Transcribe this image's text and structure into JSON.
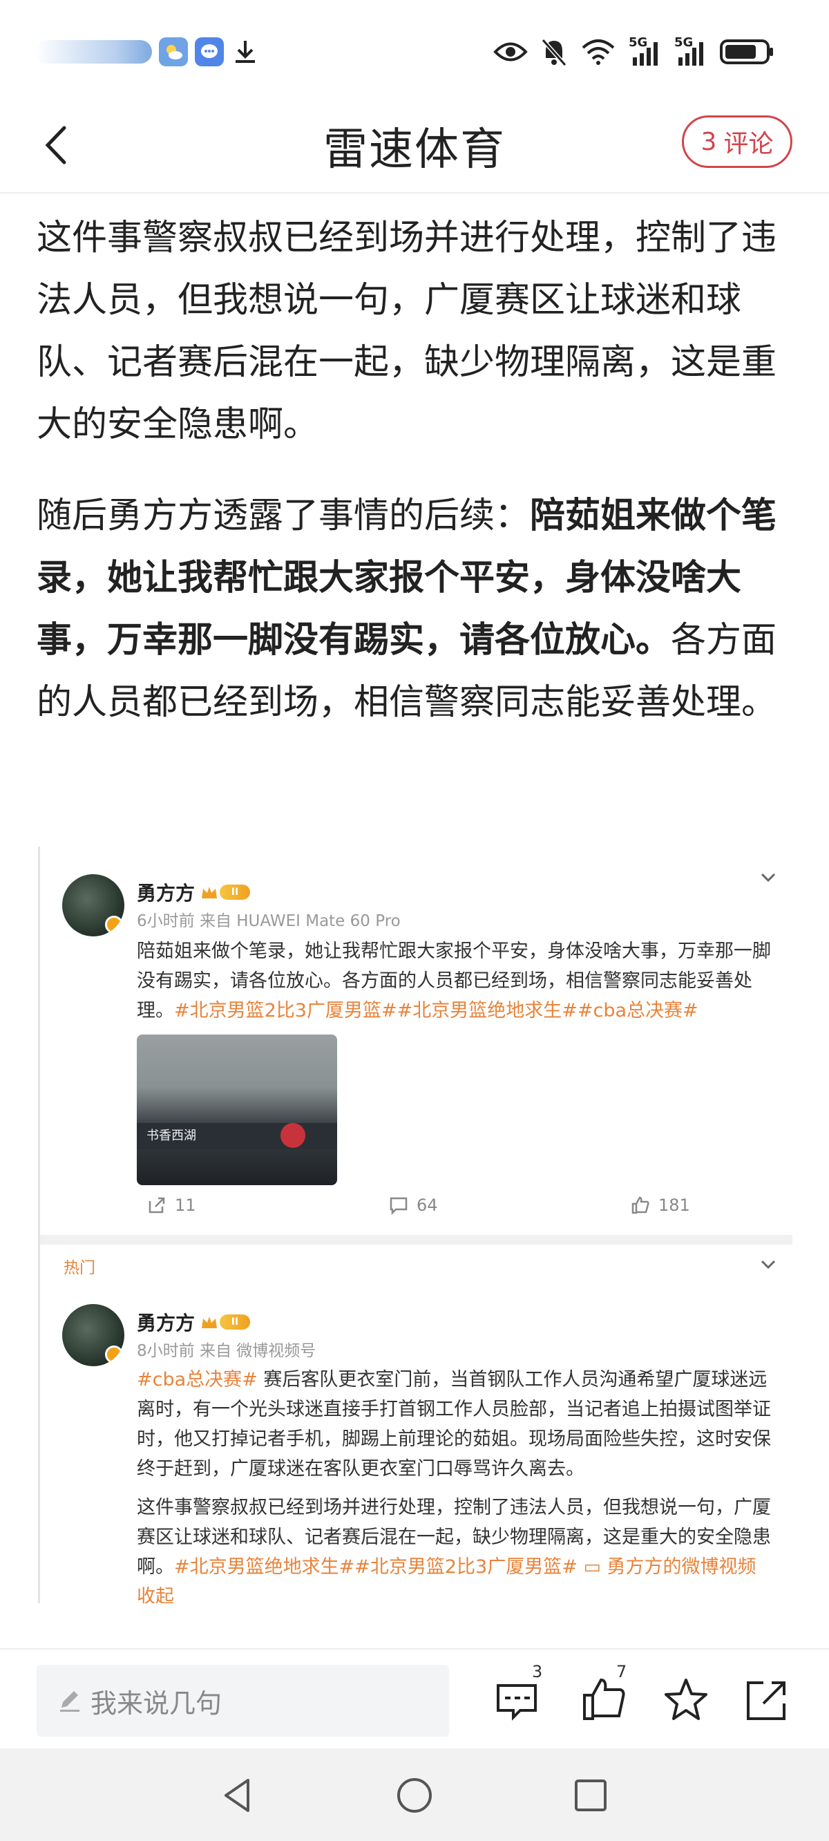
{
  "status_bar": {
    "network_left": "5G",
    "network_right": "5G"
  },
  "header": {
    "title": "雷速体育",
    "comment_count": "3",
    "comment_label": "评论"
  },
  "article": {
    "p1": "这件事警察叔叔已经到场并进行处理，控制了违法人员，但我想说一句，广厦赛区让球迷和球队、记者赛后混在一起，缺少物理隔离，这是重大的安全隐患啊。",
    "p2_normal_start": "随后勇方方透露了事情的后续：",
    "p2_bold": "陪茹姐来做个笔录，她让我帮忙跟大家报个平安，身体没啥大事，万幸那一脚没有踢实，请各位放心。",
    "p2_normal_end": "各方面的人员都已经到场，相信警察同志能妥善处理。"
  },
  "embed": {
    "post1": {
      "username": "勇方方",
      "level": "II",
      "meta": "6小时前 来自 HUAWEI Mate 60 Pro",
      "text": "陪茹姐来做个笔录，她让我帮忙跟大家报个平安，身体没啥大事，万幸那一脚没有踢实，请各位放心。各方面的人员都已经到场，相信警察同志能妥善处理。",
      "tags": "#北京男篮2比3广厦男篮##北京男篮绝地求生##cba总决赛#",
      "photo_sign": "书香西湖",
      "reposts": "11",
      "comments": "64",
      "likes": "181"
    },
    "hot_label": "热门",
    "post2": {
      "username": "勇方方",
      "level": "II",
      "meta": "8小时前 来自 微博视频号",
      "tag_start": "#cba总决赛#",
      "text1": " 赛后客队更衣室门前，当首钢队工作人员沟通希望广厦球迷远离时，有一个光头球迷直接手打首钢工作人员脸部，当记者追上拍摄试图举证时，他又打掉记者手机，脚踢上前理论的茹姐。现场局面险些失控，这时安保终于赶到，广厦球迷在客队更衣室门口辱骂许久离去。",
      "text2": "这件事警察叔叔已经到场并进行处理，控制了违法人员，但我想说一句，广厦赛区让球迷和球队、记者赛后混在一起，缺少物理隔离，这是重大的安全隐患啊。",
      "tags_end": "#北京男篮绝地求生##北京男篮2比3广厦男篮#",
      "video_link": "勇方方的微博视频",
      "collapse": "收起"
    }
  },
  "bottom_bar": {
    "input_placeholder": "我来说几句",
    "comment_badge": "3",
    "like_badge": "7"
  },
  "colors": {
    "accent_red": "#d0454c",
    "weibo_orange": "#e8833a"
  }
}
